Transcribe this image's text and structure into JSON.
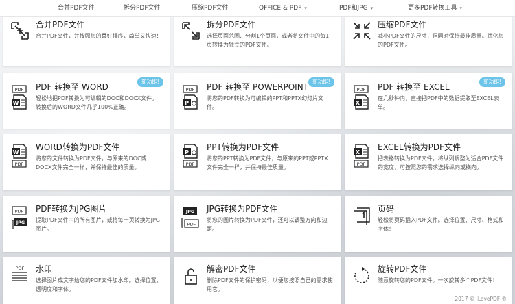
{
  "nav": [
    {
      "label": "合并PDF文件",
      "caret": false
    },
    {
      "label": "拆分PDF文件",
      "caret": false
    },
    {
      "label": "压缩PDF文件",
      "caret": false
    },
    {
      "label": "OFFICE & PDF",
      "caret": true
    },
    {
      "label": "PDF和JPG",
      "caret": true
    },
    {
      "label": "更多PDF转换工具",
      "caret": true
    }
  ],
  "badge_label": "新功能!",
  "tools": [
    {
      "title": "合并PDF文件",
      "desc": "合并PDF文件，并按照您的喜好排序，简单又快速！",
      "icon": "merge-icon"
    },
    {
      "title": "拆分PDF文件",
      "desc": "选择页面范围、分割1个页面，或者将文件中的每1页转换为独立的PDF文件。",
      "icon": "split-icon"
    },
    {
      "title": "压缩PDF文件",
      "desc": "减小PDF文件的尺寸，但同时保持最佳质量。优化您的PDF文件。",
      "icon": "compress-icon"
    },
    {
      "title": "PDF 转换至 WORD",
      "desc": "轻松地把PDF转换为可编辑的DOC和DOCX文件。转换后的WORD文件几乎100%正确。",
      "icon": "pdf-to-word-icon",
      "badge": true
    },
    {
      "title": "PDF 转换至 POWERPOINT",
      "desc": "将您的PDF转换为可编辑的PPT和PPTX幻灯片文件。",
      "icon": "pdf-to-ppt-icon",
      "badge": true
    },
    {
      "title": "PDF 转换至 EXCEL",
      "desc": "在几秒钟内，直接把PDF中的数据提取至EXCEL表单。",
      "icon": "pdf-to-excel-icon",
      "badge": true
    },
    {
      "title": "WORD转换为PDF文件",
      "desc": "将您的文件转换为PDF文件，与原来的DOC或DOCX文件完全一样，并保持最佳的质量。",
      "icon": "word-to-pdf-icon"
    },
    {
      "title": "PPT转换为PDF文件",
      "desc": "将您的PPT转换为PDF文件，与原来的PPT或PPTX文件完全一样，并保持最佳质量。",
      "icon": "ppt-to-pdf-icon"
    },
    {
      "title": "EXCEL转换为PDF文件",
      "desc": "把表格转换为PDF文件，将纵列调整为适合PDF文件的宽度，可按照您的需求选择纵向或横向。",
      "icon": "excel-to-pdf-icon"
    },
    {
      "title": "PDF转换为JPG图片",
      "desc": "提取PDF文件中的所有图片，或将每一页转换为JPG图片。",
      "icon": "pdf-to-jpg-icon"
    },
    {
      "title": "JPG转换为PDF文件",
      "desc": "将您的图片转换为PDF文件，还可以调整方向和边距。",
      "icon": "jpg-to-pdf-icon"
    },
    {
      "title": "页码",
      "desc": "轻松将页码插入PDF文件。选择位置、尺寸、格式和字体！",
      "icon": "page-numbers-icon"
    },
    {
      "title": "水印",
      "desc": "选择图片或文字给您的PDF文件加水印。选择位置、透明度和字体。",
      "icon": "watermark-icon"
    },
    {
      "title": "解密PDF文件",
      "desc": "删除PDF文件的保护密码，以便您按照自己的需求使用它。",
      "icon": "unlock-icon"
    },
    {
      "title": "旋转PDF文件",
      "desc": "随意旋转您的PDF文件。一次旋转多个PDF文件！",
      "icon": "rotate-icon"
    }
  ],
  "icon_text": {
    "pdf": "PDF",
    "jpg": "JPG",
    "w": "W",
    "p": "P",
    "x": "X"
  },
  "copyright": "2017 © iLovePDF ®"
}
